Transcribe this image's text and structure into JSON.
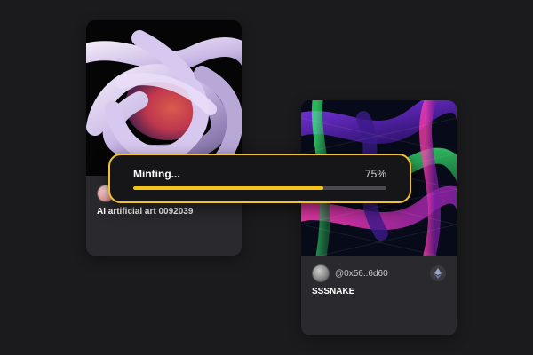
{
  "cards": [
    {
      "title": "AI artificial art 0092039",
      "owner": "",
      "avatar_color": "#f2a4a4"
    },
    {
      "title": "SSSNAKE",
      "owner": "@0x56..6d60",
      "currency_icon": "ethereum-icon"
    }
  ],
  "minting": {
    "label": "Minting...",
    "percent_label": "75%",
    "progress": 0.75,
    "accent": "#f2c230"
  },
  "colors": {
    "background": "#1b1b1d",
    "card": "#2a2a2e",
    "progress_fill": "#f4c418"
  }
}
